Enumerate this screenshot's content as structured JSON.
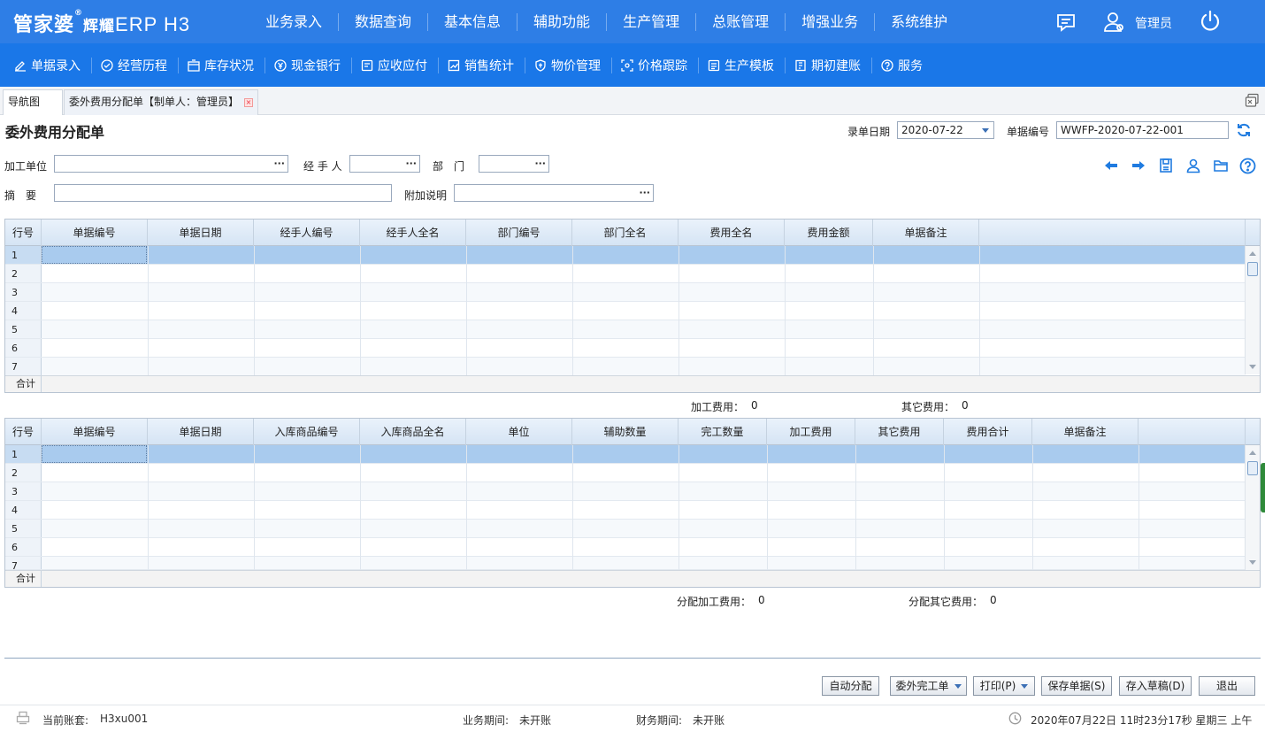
{
  "app": {
    "logo_main": "管家婆",
    "logo_reg": "®",
    "logo_sub": "辉耀",
    "logo_product": "ERP H3",
    "user": "管理员"
  },
  "main_menu": [
    "业务录入",
    "数据查询",
    "基本信息",
    "辅助功能",
    "生产管理",
    "总账管理",
    "增强业务",
    "系统维护"
  ],
  "sub_menu": [
    {
      "label": "单据录入",
      "icon": "edit-icon"
    },
    {
      "label": "经营历程",
      "icon": "check-circle-icon"
    },
    {
      "label": "库存状况",
      "icon": "warehouse-icon"
    },
    {
      "label": "现金银行",
      "icon": "yen-icon"
    },
    {
      "label": "应收应付",
      "icon": "ledger-icon"
    },
    {
      "label": "销售统计",
      "icon": "chart-icon"
    },
    {
      "label": "物价管理",
      "icon": "shield-icon"
    },
    {
      "label": "价格跟踪",
      "icon": "tracking-icon"
    },
    {
      "label": "生产模板",
      "icon": "template-icon"
    },
    {
      "label": "期初建账",
      "icon": "book-icon"
    },
    {
      "label": "服务",
      "icon": "help-icon"
    }
  ],
  "tabs": {
    "nav": "导航图",
    "doc": "委外费用分配单【制单人：管理员】"
  },
  "form": {
    "title": "委外费用分配单",
    "date_label": "录单日期",
    "date_value": "2020-07-22",
    "no_label": "单据编号",
    "no_value": "WWFP-2020-07-22-001",
    "unit_label": "加工单位",
    "unit_value": "",
    "handler_label": "经 手 人",
    "handler_value": "",
    "dept_label": "部　门",
    "dept_value": "",
    "summary_label": "摘　要",
    "summary_value": "",
    "note_label": "附加说明",
    "note_value": "",
    "dots": "···"
  },
  "grid1": {
    "columns": [
      "行号",
      "单据编号",
      "单据日期",
      "经手人编号",
      "经手人全名",
      "部门编号",
      "部门全名",
      "费用全名",
      "费用金额",
      "单据备注"
    ],
    "rows": [
      "1",
      "2",
      "3",
      "4",
      "5",
      "6",
      "7"
    ],
    "sum_label": "合计"
  },
  "totals1": {
    "proc_label": "加工费用：",
    "proc_value": "0",
    "other_label": "其它费用：",
    "other_value": "0"
  },
  "grid2": {
    "columns": [
      "行号",
      "单据编号",
      "单据日期",
      "入库商品编号",
      "入库商品全名",
      "单位",
      "辅助数量",
      "完工数量",
      "加工费用",
      "其它费用",
      "费用合计",
      "单据备注"
    ],
    "rows": [
      "1",
      "2",
      "3",
      "4",
      "5",
      "6",
      "7"
    ],
    "sum_label": "合计"
  },
  "totals2": {
    "proc_label": "分配加工费用：",
    "proc_value": "0",
    "other_label": "分配其它费用：",
    "other_value": "0"
  },
  "buttons": {
    "auto": "自动分配",
    "finish": "委外完工单",
    "print": "打印(P)",
    "save": "保存单据(S)",
    "draft": "存入草稿(D)",
    "exit": "退出"
  },
  "status": {
    "account_label": "当前账套:",
    "account_value": "H3xu001",
    "biz_label": "业务期间:",
    "biz_value": "未开账",
    "fin_label": "财务期间:",
    "fin_value": "未开账",
    "datetime": "2020年07月22日 11时23分17秒 星期三 上午"
  },
  "colors": {
    "topbar": "#2e7ee6",
    "subbar": "#1a77e8",
    "selected_row": "#a9cbee",
    "icon_blue": "#1f7be0"
  }
}
